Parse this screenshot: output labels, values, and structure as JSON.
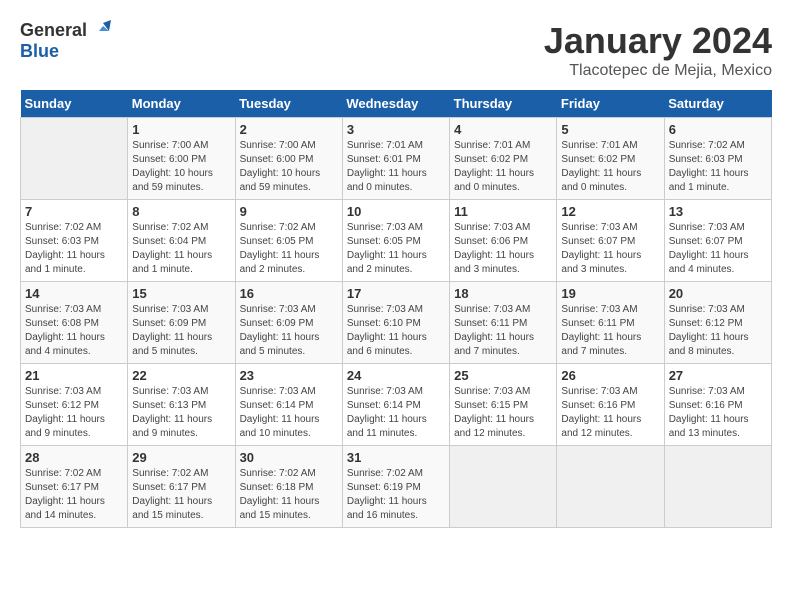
{
  "logo": {
    "text_general": "General",
    "text_blue": "Blue"
  },
  "title": "January 2024",
  "location": "Tlacotepec de Mejia, Mexico",
  "days_header": [
    "Sunday",
    "Monday",
    "Tuesday",
    "Wednesday",
    "Thursday",
    "Friday",
    "Saturday"
  ],
  "weeks": [
    [
      {
        "day": "",
        "info": ""
      },
      {
        "day": "1",
        "info": "Sunrise: 7:00 AM\nSunset: 6:00 PM\nDaylight: 10 hours\nand 59 minutes."
      },
      {
        "day": "2",
        "info": "Sunrise: 7:00 AM\nSunset: 6:00 PM\nDaylight: 10 hours\nand 59 minutes."
      },
      {
        "day": "3",
        "info": "Sunrise: 7:01 AM\nSunset: 6:01 PM\nDaylight: 11 hours\nand 0 minutes."
      },
      {
        "day": "4",
        "info": "Sunrise: 7:01 AM\nSunset: 6:02 PM\nDaylight: 11 hours\nand 0 minutes."
      },
      {
        "day": "5",
        "info": "Sunrise: 7:01 AM\nSunset: 6:02 PM\nDaylight: 11 hours\nand 0 minutes."
      },
      {
        "day": "6",
        "info": "Sunrise: 7:02 AM\nSunset: 6:03 PM\nDaylight: 11 hours\nand 1 minute."
      }
    ],
    [
      {
        "day": "7",
        "info": "Sunrise: 7:02 AM\nSunset: 6:03 PM\nDaylight: 11 hours\nand 1 minute."
      },
      {
        "day": "8",
        "info": "Sunrise: 7:02 AM\nSunset: 6:04 PM\nDaylight: 11 hours\nand 1 minute."
      },
      {
        "day": "9",
        "info": "Sunrise: 7:02 AM\nSunset: 6:05 PM\nDaylight: 11 hours\nand 2 minutes."
      },
      {
        "day": "10",
        "info": "Sunrise: 7:03 AM\nSunset: 6:05 PM\nDaylight: 11 hours\nand 2 minutes."
      },
      {
        "day": "11",
        "info": "Sunrise: 7:03 AM\nSunset: 6:06 PM\nDaylight: 11 hours\nand 3 minutes."
      },
      {
        "day": "12",
        "info": "Sunrise: 7:03 AM\nSunset: 6:07 PM\nDaylight: 11 hours\nand 3 minutes."
      },
      {
        "day": "13",
        "info": "Sunrise: 7:03 AM\nSunset: 6:07 PM\nDaylight: 11 hours\nand 4 minutes."
      }
    ],
    [
      {
        "day": "14",
        "info": "Sunrise: 7:03 AM\nSunset: 6:08 PM\nDaylight: 11 hours\nand 4 minutes."
      },
      {
        "day": "15",
        "info": "Sunrise: 7:03 AM\nSunset: 6:09 PM\nDaylight: 11 hours\nand 5 minutes."
      },
      {
        "day": "16",
        "info": "Sunrise: 7:03 AM\nSunset: 6:09 PM\nDaylight: 11 hours\nand 5 minutes."
      },
      {
        "day": "17",
        "info": "Sunrise: 7:03 AM\nSunset: 6:10 PM\nDaylight: 11 hours\nand 6 minutes."
      },
      {
        "day": "18",
        "info": "Sunrise: 7:03 AM\nSunset: 6:11 PM\nDaylight: 11 hours\nand 7 minutes."
      },
      {
        "day": "19",
        "info": "Sunrise: 7:03 AM\nSunset: 6:11 PM\nDaylight: 11 hours\nand 7 minutes."
      },
      {
        "day": "20",
        "info": "Sunrise: 7:03 AM\nSunset: 6:12 PM\nDaylight: 11 hours\nand 8 minutes."
      }
    ],
    [
      {
        "day": "21",
        "info": "Sunrise: 7:03 AM\nSunset: 6:12 PM\nDaylight: 11 hours\nand 9 minutes."
      },
      {
        "day": "22",
        "info": "Sunrise: 7:03 AM\nSunset: 6:13 PM\nDaylight: 11 hours\nand 9 minutes."
      },
      {
        "day": "23",
        "info": "Sunrise: 7:03 AM\nSunset: 6:14 PM\nDaylight: 11 hours\nand 10 minutes."
      },
      {
        "day": "24",
        "info": "Sunrise: 7:03 AM\nSunset: 6:14 PM\nDaylight: 11 hours\nand 11 minutes."
      },
      {
        "day": "25",
        "info": "Sunrise: 7:03 AM\nSunset: 6:15 PM\nDaylight: 11 hours\nand 12 minutes."
      },
      {
        "day": "26",
        "info": "Sunrise: 7:03 AM\nSunset: 6:16 PM\nDaylight: 11 hours\nand 12 minutes."
      },
      {
        "day": "27",
        "info": "Sunrise: 7:03 AM\nSunset: 6:16 PM\nDaylight: 11 hours\nand 13 minutes."
      }
    ],
    [
      {
        "day": "28",
        "info": "Sunrise: 7:02 AM\nSunset: 6:17 PM\nDaylight: 11 hours\nand 14 minutes."
      },
      {
        "day": "29",
        "info": "Sunrise: 7:02 AM\nSunset: 6:17 PM\nDaylight: 11 hours\nand 15 minutes."
      },
      {
        "day": "30",
        "info": "Sunrise: 7:02 AM\nSunset: 6:18 PM\nDaylight: 11 hours\nand 15 minutes."
      },
      {
        "day": "31",
        "info": "Sunrise: 7:02 AM\nSunset: 6:19 PM\nDaylight: 11 hours\nand 16 minutes."
      },
      {
        "day": "",
        "info": ""
      },
      {
        "day": "",
        "info": ""
      },
      {
        "day": "",
        "info": ""
      }
    ]
  ]
}
